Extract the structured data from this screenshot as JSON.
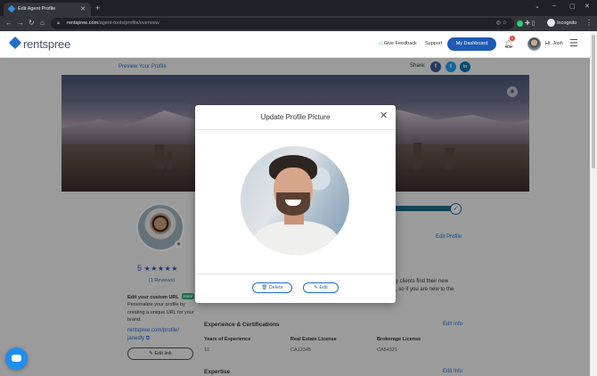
{
  "browser": {
    "tab_title": "Edit Agent Profile",
    "url_host": "rentspree.com",
    "url_path": "/agent-tools/profile/overview",
    "incognito_label": "Incognito"
  },
  "header": {
    "logo_text": "rentspree",
    "give_feedback": "Give Feedback",
    "support": "Support",
    "dashboard_button": "My Dashboard",
    "notification_count": "1",
    "greeting": "Hi, Josh"
  },
  "page": {
    "preview_link": "Preview Your Profile",
    "share_label": "Share:",
    "share_icons": [
      "f",
      "t",
      "in"
    ],
    "rating_value": "5",
    "stars": "★★★★★",
    "reviews": "(1 Reviews)",
    "custom_url_title": "Edit your custom URL",
    "free_badge": "FREE",
    "custom_url_desc": "Personalize your profile by creating a unique URL for your brand.",
    "custom_url_line1": "rentspree.com/profile/",
    "custom_url_line2": "janedly",
    "edit_link_button": "Edit link",
    "edit_profile": "Edit Profile",
    "bio_line1": "y clients find their new",
    "bio_line2": ", so if you are new to the",
    "experience_title": "Experience & Certifications",
    "edit_info": "Edit Info",
    "experience": [
      {
        "label": "Years of Experience",
        "value": "10"
      },
      {
        "label": "Real Estate License",
        "value": "CA12345"
      },
      {
        "label": "Brokerage License",
        "value": "CA54321"
      }
    ],
    "expertise_title": "Expertise",
    "expertise_edit": "Edit Info"
  },
  "modal": {
    "title": "Update Profile Picture",
    "delete_button": "Delete",
    "edit_button": "Edit"
  }
}
